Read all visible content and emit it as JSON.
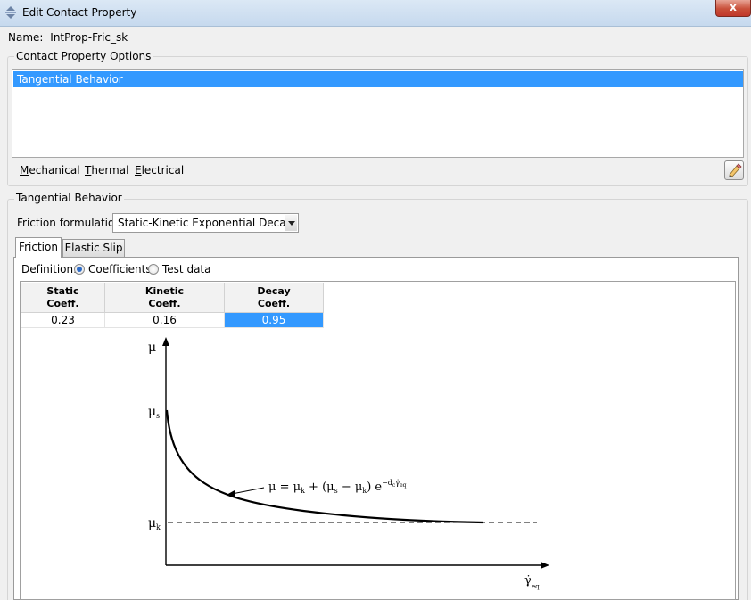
{
  "window": {
    "title": "Edit Contact Property",
    "close_glyph": "x",
    "icon": "app-icon"
  },
  "name_field": {
    "label": "Name:",
    "value": "IntProp-Fric_sk"
  },
  "options_group": {
    "title": "Contact Property Options",
    "items": [
      "Tangential Behavior"
    ],
    "selected_index": 0
  },
  "menubar": {
    "items": [
      {
        "label": "Mechanical",
        "mnemonic": "M"
      },
      {
        "label": "Thermal",
        "mnemonic": "T"
      },
      {
        "label": "Electrical",
        "mnemonic": "E"
      }
    ],
    "edit_icon": "pencil-eraser-icon"
  },
  "behavior_group": {
    "title": "Tangential Behavior",
    "formulation_label": "Friction formulation:",
    "formulation_value": "Static-Kinetic Exponential Decay"
  },
  "tabs": [
    {
      "label": "Friction",
      "active": true
    },
    {
      "label": "Elastic Slip",
      "active": false
    }
  ],
  "definition": {
    "label": "Definition:",
    "options": [
      {
        "label": "Coefficients",
        "checked": true
      },
      {
        "label": "Test data",
        "checked": false
      }
    ]
  },
  "table": {
    "headers": [
      [
        "Static",
        "Coeff."
      ],
      [
        "Kinetic",
        "Coeff."
      ],
      [
        "Decay",
        "Coeff."
      ]
    ],
    "row": [
      "0.23",
      "0.16",
      "0.95"
    ],
    "selected_col": 2
  },
  "diagram": {
    "y_axis_label": "μ",
    "mu_s_label": "μ",
    "mu_s_sub": "s",
    "mu_k_label": "μ",
    "mu_k_sub": "k",
    "x_axis_label": "γ̇",
    "x_axis_sub": "eq",
    "equation": "μ = μ",
    "equation_parts": {
      "k1": "k",
      "mid": " + (μ",
      "s": "s",
      "minus": " − μ",
      "k2": "k",
      "close": ") e",
      "exp": "−d",
      "exp_sub": "c",
      "exp_gamma": "γ̇",
      "exp_gamma_sub": "eq"
    }
  },
  "colors": {
    "selection": "#3399ff",
    "titlebar": "#c6d9ee",
    "close": "#c0392b"
  }
}
